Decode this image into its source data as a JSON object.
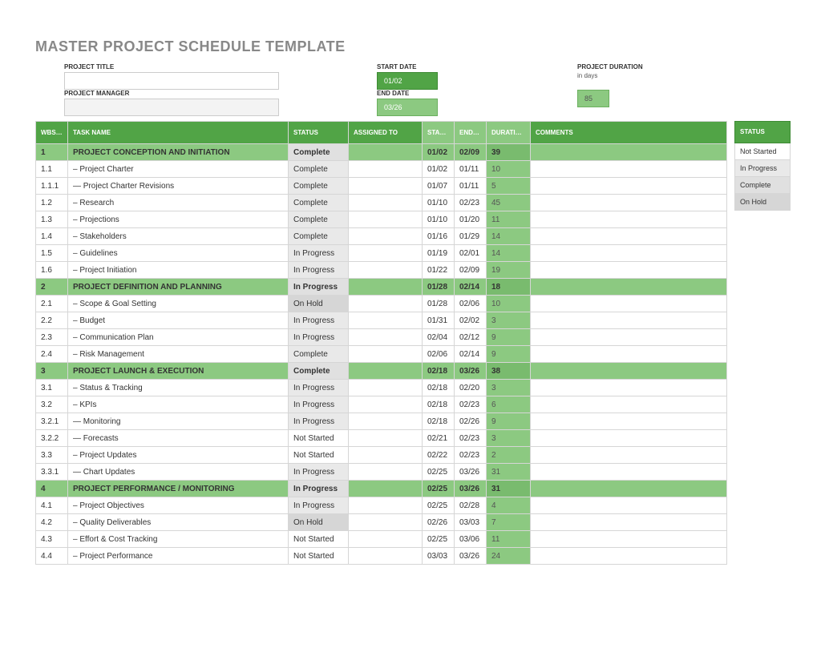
{
  "title": "MASTER PROJECT SCHEDULE TEMPLATE",
  "meta": {
    "project_title_label": "PROJECT TITLE",
    "project_manager_label": "PROJECT MANAGER",
    "start_date_label": "START DATE",
    "end_date_label": "END DATE",
    "start_date": "01/02",
    "end_date": "03/26",
    "duration_label": "PROJECT DURATION",
    "duration_sub": "in days",
    "duration_value": "85"
  },
  "headers": {
    "wbs": "WBS NO.",
    "task": "TASK NAME",
    "status": "STATUS",
    "assigned": "ASSIGNED TO",
    "start": "START DATE",
    "end": "END DATE",
    "duration": "DURATION in days",
    "comments": "COMMENTS"
  },
  "legend": {
    "header": "STATUS",
    "not_started": "Not Started",
    "in_progress": "In Progress",
    "complete": "Complete",
    "on_hold": "On Hold"
  },
  "rows": [
    {
      "type": "section",
      "wbs": "1",
      "task": "PROJECT CONCEPTION AND INITIATION",
      "status": "Complete",
      "start": "01/02",
      "end": "02/09",
      "dur": "39"
    },
    {
      "type": "row",
      "wbs": "1.1",
      "task": "Project Charter",
      "indent": 1,
      "status": "Complete",
      "start": "01/02",
      "end": "01/11",
      "dur": "10"
    },
    {
      "type": "row",
      "wbs": "1.1.1",
      "task": "Project Charter Revisions",
      "indent": 2,
      "status": "Complete",
      "start": "01/07",
      "end": "01/11",
      "dur": "5"
    },
    {
      "type": "row",
      "wbs": "1.2",
      "task": "Research",
      "indent": 1,
      "status": "Complete",
      "start": "01/10",
      "end": "02/23",
      "dur": "45"
    },
    {
      "type": "row",
      "wbs": "1.3",
      "task": "Projections",
      "indent": 1,
      "status": "Complete",
      "start": "01/10",
      "end": "01/20",
      "dur": "11"
    },
    {
      "type": "row",
      "wbs": "1.4",
      "task": "Stakeholders",
      "indent": 1,
      "status": "Complete",
      "start": "01/16",
      "end": "01/29",
      "dur": "14"
    },
    {
      "type": "row",
      "wbs": "1.5",
      "task": "Guidelines",
      "indent": 1,
      "status": "In Progress",
      "start": "01/19",
      "end": "02/01",
      "dur": "14"
    },
    {
      "type": "row",
      "wbs": "1.6",
      "task": "Project Initiation",
      "indent": 1,
      "status": "In Progress",
      "start": "01/22",
      "end": "02/09",
      "dur": "19"
    },
    {
      "type": "section",
      "wbs": "2",
      "task": "PROJECT DEFINITION AND PLANNING",
      "status": "In Progress",
      "start": "01/28",
      "end": "02/14",
      "dur": "18"
    },
    {
      "type": "row",
      "wbs": "2.1",
      "task": "Scope & Goal Setting",
      "indent": 1,
      "status": "On Hold",
      "start": "01/28",
      "end": "02/06",
      "dur": "10"
    },
    {
      "type": "row",
      "wbs": "2.2",
      "task": "Budget",
      "indent": 1,
      "status": "In Progress",
      "start": "01/31",
      "end": "02/02",
      "dur": "3"
    },
    {
      "type": "row",
      "wbs": "2.3",
      "task": "Communication Plan",
      "indent": 1,
      "status": "In Progress",
      "start": "02/04",
      "end": "02/12",
      "dur": "9"
    },
    {
      "type": "row",
      "wbs": "2.4",
      "task": "Risk Management",
      "indent": 1,
      "status": "Complete",
      "start": "02/06",
      "end": "02/14",
      "dur": "9"
    },
    {
      "type": "section",
      "wbs": "3",
      "task": "PROJECT LAUNCH & EXECUTION",
      "status": "Complete",
      "start": "02/18",
      "end": "03/26",
      "dur": "38"
    },
    {
      "type": "row",
      "wbs": "3.1",
      "task": "Status & Tracking",
      "indent": 1,
      "status": "In Progress",
      "start": "02/18",
      "end": "02/20",
      "dur": "3"
    },
    {
      "type": "row",
      "wbs": "3.2",
      "task": "KPIs",
      "indent": 1,
      "status": "In Progress",
      "start": "02/18",
      "end": "02/23",
      "dur": "6"
    },
    {
      "type": "row",
      "wbs": "3.2.1",
      "task": "Monitoring",
      "indent": 2,
      "status": "In Progress",
      "start": "02/18",
      "end": "02/26",
      "dur": "9"
    },
    {
      "type": "row",
      "wbs": "3.2.2",
      "task": "Forecasts",
      "indent": 2,
      "status": "Not Started",
      "start": "02/21",
      "end": "02/23",
      "dur": "3"
    },
    {
      "type": "row",
      "wbs": "3.3",
      "task": "Project Updates",
      "indent": 1,
      "status": "Not Started",
      "start": "02/22",
      "end": "02/23",
      "dur": "2"
    },
    {
      "type": "row",
      "wbs": "3.3.1",
      "task": "Chart Updates",
      "indent": 2,
      "status": "In Progress",
      "start": "02/25",
      "end": "03/26",
      "dur": "31"
    },
    {
      "type": "section",
      "wbs": "4",
      "task": "PROJECT PERFORMANCE / MONITORING",
      "status": "In Progress",
      "start": "02/25",
      "end": "03/26",
      "dur": "31"
    },
    {
      "type": "row",
      "wbs": "4.1",
      "task": "Project Objectives",
      "indent": 1,
      "status": "In Progress",
      "start": "02/25",
      "end": "02/28",
      "dur": "4"
    },
    {
      "type": "row",
      "wbs": "4.2",
      "task": "Quality Deliverables",
      "indent": 1,
      "status": "On Hold",
      "start": "02/26",
      "end": "03/03",
      "dur": "7"
    },
    {
      "type": "row",
      "wbs": "4.3",
      "task": "Effort & Cost Tracking",
      "indent": 1,
      "status": "Not Started",
      "start": "02/25",
      "end": "03/06",
      "dur": "11"
    },
    {
      "type": "row",
      "wbs": "4.4",
      "task": "Project Performance",
      "indent": 1,
      "status": "Not Started",
      "start": "03/03",
      "end": "03/26",
      "dur": "24"
    }
  ]
}
